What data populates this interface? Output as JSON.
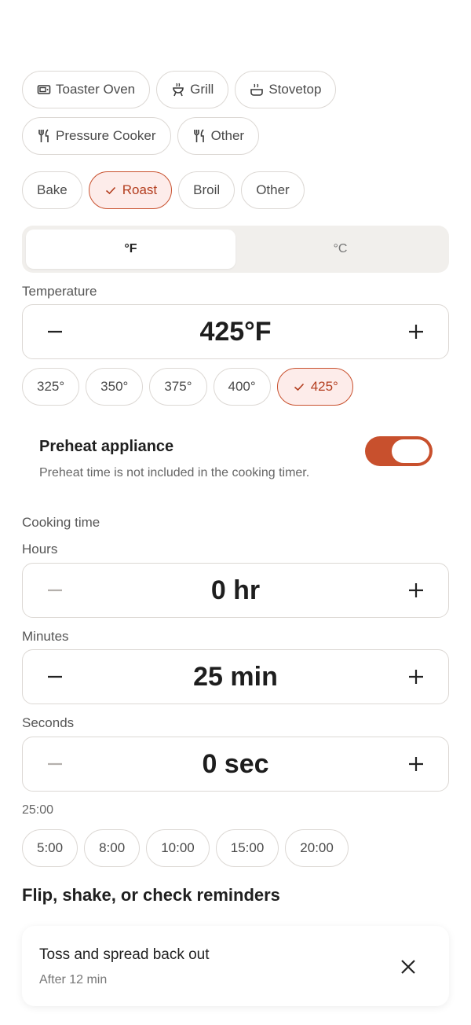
{
  "appliances": [
    {
      "label": "Toaster Oven",
      "icon": "toaster-oven-icon"
    },
    {
      "label": "Grill",
      "icon": "grill-icon"
    },
    {
      "label": "Stovetop",
      "icon": "stovetop-icon"
    },
    {
      "label": "Pressure Cooker",
      "icon": "utensils-icon"
    },
    {
      "label": "Other",
      "icon": "utensils-icon"
    }
  ],
  "methods": [
    {
      "label": "Bake",
      "selected": false
    },
    {
      "label": "Roast",
      "selected": true
    },
    {
      "label": "Broil",
      "selected": false
    },
    {
      "label": "Other",
      "selected": false
    }
  ],
  "units": {
    "fahrenheit": "°F",
    "celsius": "°C",
    "active": "fahrenheit"
  },
  "temperature": {
    "label": "Temperature",
    "value": "425°F",
    "presets": [
      {
        "label": "325°",
        "selected": false
      },
      {
        "label": "350°",
        "selected": false
      },
      {
        "label": "375°",
        "selected": false
      },
      {
        "label": "400°",
        "selected": false
      },
      {
        "label": "425°",
        "selected": true
      }
    ]
  },
  "preheat": {
    "title": "Preheat appliance",
    "subtitle": "Preheat time is not included in the cooking timer.",
    "enabled": true
  },
  "cooking_time": {
    "label": "Cooking time",
    "hours_label": "Hours",
    "hours_value": "0 hr",
    "minutes_label": "Minutes",
    "minutes_value": "25 min",
    "seconds_label": "Seconds",
    "seconds_value": "0 sec",
    "total": "25:00",
    "presets": [
      "5:00",
      "8:00",
      "10:00",
      "15:00",
      "20:00"
    ]
  },
  "reminders": {
    "heading": "Flip, shake, or check reminders",
    "items": [
      {
        "title": "Toss and spread back out",
        "subtitle": "After 12 min"
      }
    ]
  },
  "colors": {
    "accent": "#c8502d",
    "accent_bg": "#fdecea",
    "border": "#dcd8d4"
  }
}
